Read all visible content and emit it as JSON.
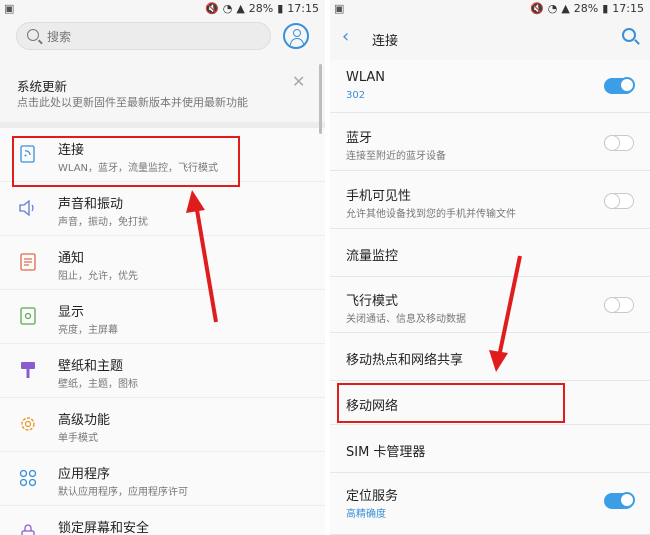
{
  "status_left": {
    "time": "17:15",
    "battery": "28%"
  },
  "status_right": {
    "time": "17:15",
    "battery": "28%"
  },
  "settings": {
    "search_placeholder": "搜索",
    "update_card": {
      "title": "系统更新",
      "subtitle": "点击此处以更新固件至最新版本并使用最新功能"
    },
    "items": [
      {
        "icon": "connection-icon",
        "title": "连接",
        "subtitle": "WLAN，蓝牙，流量监控，飞行模式"
      },
      {
        "icon": "sound-icon",
        "title": "声音和振动",
        "subtitle": "声音，振动，免打扰"
      },
      {
        "icon": "notification-icon",
        "title": "通知",
        "subtitle": "阻止，允许，优先"
      },
      {
        "icon": "display-icon",
        "title": "显示",
        "subtitle": "亮度，主屏幕"
      },
      {
        "icon": "wallpaper-icon",
        "title": "壁纸和主题",
        "subtitle": "壁纸，主题，图标"
      },
      {
        "icon": "advanced-features-icon",
        "title": "高级功能",
        "subtitle": "单手模式"
      },
      {
        "icon": "apps-icon",
        "title": "应用程序",
        "subtitle": "默认应用程序，应用程序许可"
      },
      {
        "icon": "lock-icon",
        "title": "锁定屏幕和安全",
        "subtitle": ""
      }
    ]
  },
  "connections": {
    "title": "连接",
    "items": [
      {
        "title": "WLAN",
        "subtitle": "302",
        "toggle": "on"
      },
      {
        "title": "蓝牙",
        "subtitle": "连接至附近的蓝牙设备",
        "toggle": "off"
      },
      {
        "title": "手机可见性",
        "subtitle": "允许其他设备找到您的手机并传输文件",
        "toggle": "off"
      },
      {
        "title": "流量监控",
        "subtitle": ""
      },
      {
        "title": "飞行模式",
        "subtitle": "关闭通话、信息及移动数据",
        "toggle": "off"
      },
      {
        "title": "移动热点和网络共享",
        "subtitle": ""
      },
      {
        "title": "移动网络",
        "subtitle": ""
      },
      {
        "title": "SIM 卡管理器",
        "subtitle": ""
      },
      {
        "title": "定位服务",
        "subtitle": "高精确度",
        "toggle": "on"
      }
    ]
  },
  "colors": {
    "accent": "#3a8fd9",
    "highlight": "#e01d1d"
  }
}
